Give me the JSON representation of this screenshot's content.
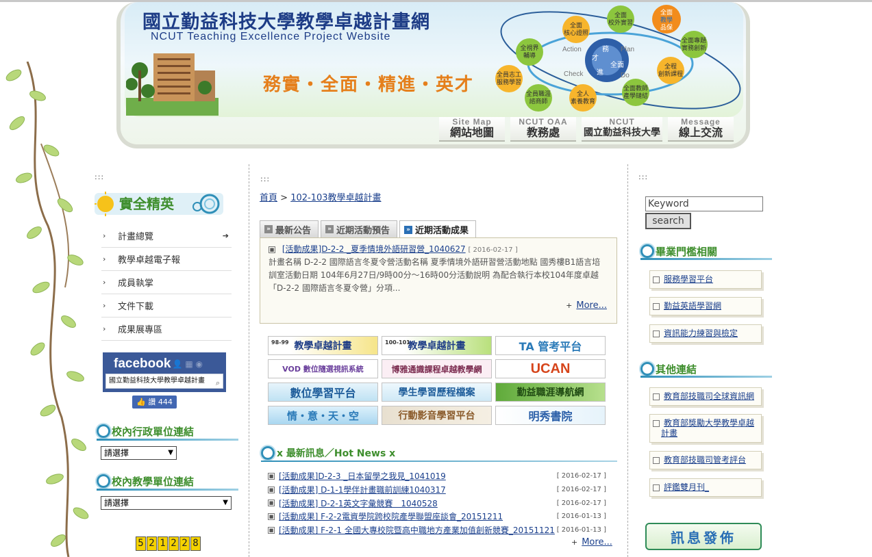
{
  "header": {
    "title": "國立勤益科技大學教學卓越計畫網",
    "subtitle": "NCUT Teaching Excellence Project Website",
    "slogan": "務實・全面・精進・英才",
    "nav": [
      {
        "en": "Site Map",
        "zh": "網站地圖"
      },
      {
        "en": "NCUT OAA",
        "zh": "教務處"
      },
      {
        "en": "NCUT",
        "zh": "國立勤益科技大學"
      },
      {
        "en": "Message",
        "zh": "線上交流"
      }
    ]
  },
  "left": {
    "dots": ":::",
    "logo_text": "實全精英",
    "menu": [
      "計畫總覽",
      "教學卓越電子報",
      "成員執掌",
      "文件下載",
      "成果展專區"
    ],
    "facebook": {
      "title": "facebook",
      "page_name": "國立勤益科技大學教學卓越計畫",
      "like_label": "讚 444"
    },
    "admin_links_title": "校內行政單位連結",
    "admin_select": "請選擇",
    "teaching_links_title": "校內教學單位連結",
    "teaching_select": "請選擇",
    "counter": [
      "5",
      "2",
      "1",
      "2",
      "2",
      "8"
    ]
  },
  "main": {
    "dots": ":::",
    "breadcrumb": {
      "home": "首頁",
      "sep": ">",
      "current": "102-103教學卓越計畫"
    },
    "tabs": [
      "最新公告",
      "近期活動預告",
      "近期活動成果"
    ],
    "featured": {
      "title": "[活動成果]D-2-2 _夏季情境外語研習營_1040627",
      "date": "[ 2016-02-17 ]",
      "body": "計畫名稱 D-2-2 國際語言冬夏令營活動名稱 夏季情境外語研習營活動地點 國秀樓B1語言培訓室活動日期 104年6月27日/9時00分～16時00分活動說明 為配合執行本校104年度卓越「D-2-2 國際語言冬夏令營」分項...",
      "more": "More..."
    },
    "banners": [
      {
        "tag": "98-99",
        "label": "教學卓越計畫"
      },
      {
        "tag": "100-101",
        "label": "教學卓越計畫"
      },
      {
        "tag": "",
        "label": "TA 管考平台"
      },
      {
        "tag": "",
        "label": "VOD 數位隨選視訊系統"
      },
      {
        "tag": "",
        "label": "博雅通識課程卓越教學網"
      },
      {
        "tag": "",
        "label": "UCAN"
      },
      {
        "tag": "",
        "label": "數位學習平台"
      },
      {
        "tag": "",
        "label": "學生學習歷程檔案"
      },
      {
        "tag": "",
        "label": "勤益職涯導航網"
      },
      {
        "tag": "",
        "label": "情・意・天・空"
      },
      {
        "tag": "",
        "label": "行動影音學習平台"
      },
      {
        "tag": "",
        "label": "明秀書院"
      }
    ],
    "hot_news_title": "x 最新訊息／Hot News x",
    "hot_news": [
      {
        "title": "[活動成果]D-2-3 _日本留學之我見_1041019",
        "date": "[ 2016-02-17 ]"
      },
      {
        "title": "[活動成果] D-1-1學伴計畫職前訓練1040317",
        "date": "[ 2016-02-17 ]"
      },
      {
        "title": "[活動成果] D-2-1英文字彙競賽＿1040528",
        "date": "[ 2016-02-17 ]"
      },
      {
        "title": "[活動成果] F-2-2電資學院跨校院產學聯盟座談會_20151211",
        "date": "[ 2016-01-13 ]"
      },
      {
        "title": "[活動成果] F-2-1 全國大專校院暨高中職地方產業加值創新競賽_20151121",
        "date": "[ 2016-01-13 ]"
      }
    ],
    "more": "More..."
  },
  "right": {
    "dots": ":::",
    "search_value": "Keyword",
    "search_button": "search",
    "grad_title": "畢業門檻相關",
    "grad_links": [
      "服務學習平台",
      "勤益英語學習網",
      "資訊能力練習與檢定"
    ],
    "other_title": "其他連結",
    "other_links": [
      "教育部技職司全球資訊網",
      "教育部獎勵大學教學卓越計畫",
      "教育部技職司管考評台",
      "評鑑雙月刊_"
    ],
    "message_button": "訊息發佈"
  },
  "colors": {
    "accent_blue": "#2f8fb8",
    "heading_green": "#3e8e2d",
    "link": "#1a3f8c",
    "slogan_orange": "#e57f1b"
  }
}
